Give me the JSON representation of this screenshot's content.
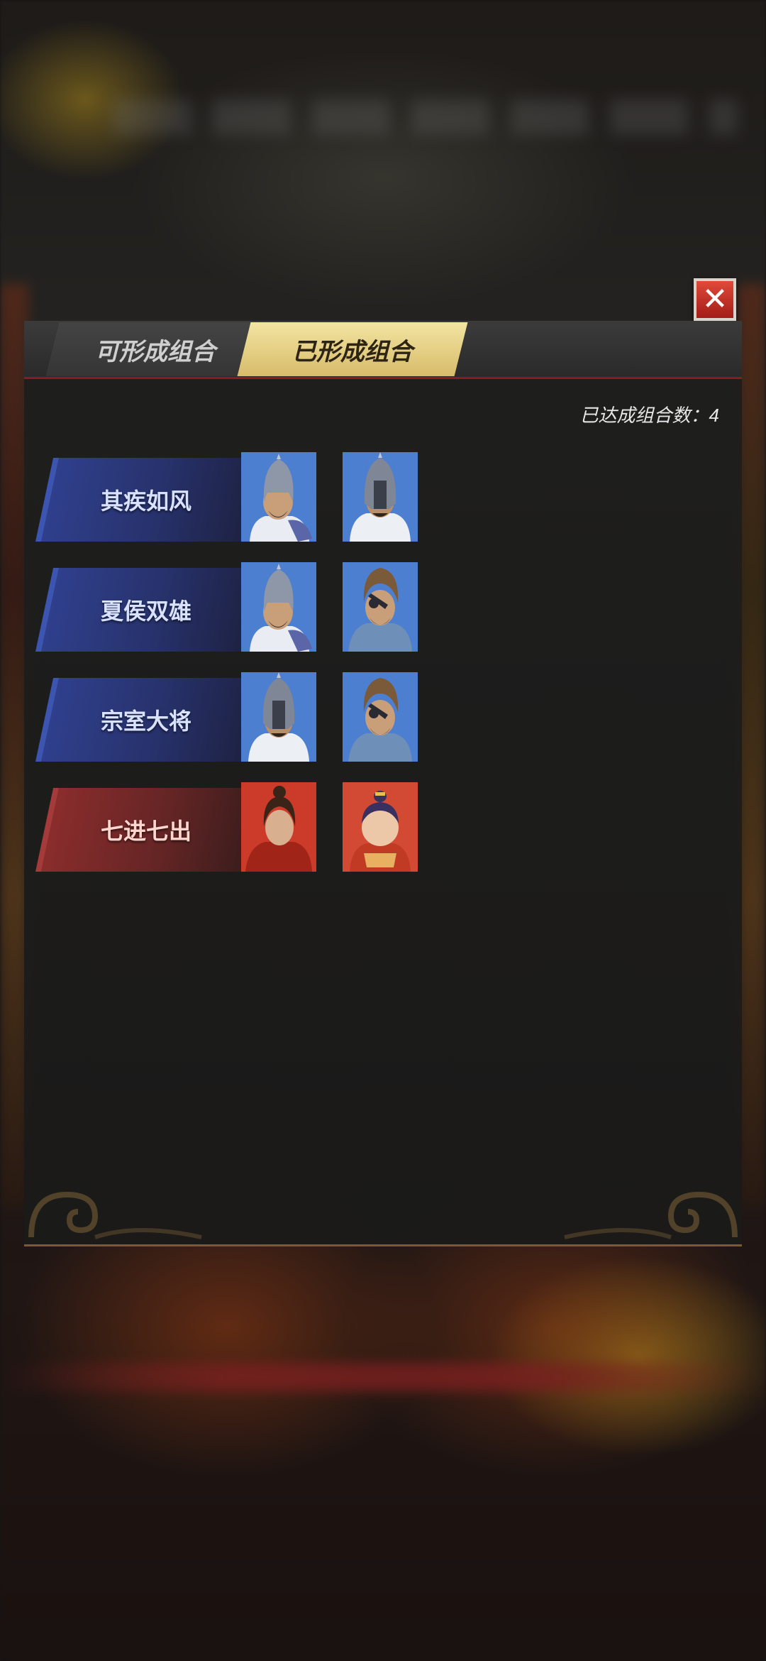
{
  "close_button": {
    "icon": "close-icon",
    "label": "✕"
  },
  "tabs": [
    {
      "label": "可形成组合",
      "active": false
    },
    {
      "label": "已形成组合",
      "active": true
    }
  ],
  "combo_count": "已达成组合数：4",
  "combos": [
    {
      "name": "其疾如风",
      "color": "blue",
      "heroes": [
        "helmet-hero-portrait",
        "visored-hero-portrait"
      ]
    },
    {
      "name": "夏侯双雄",
      "color": "blue",
      "heroes": [
        "helmet-hero-portrait",
        "eyepatch-hero-portrait"
      ]
    },
    {
      "name": "宗室大将",
      "color": "blue",
      "heroes": [
        "visored-hero-portrait",
        "eyepatch-hero-portrait"
      ]
    },
    {
      "name": "七进七出",
      "color": "red",
      "heroes": [
        "topknot-warrior-portrait",
        "child-hero-portrait"
      ]
    }
  ],
  "colors": {
    "banner_blue": "#2f3f8c",
    "banner_red": "#8a2c2c",
    "active_tab": "#f3e4a2",
    "close_red": "#c83a2e"
  }
}
